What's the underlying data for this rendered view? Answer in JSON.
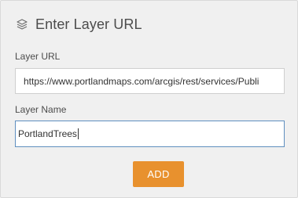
{
  "header": {
    "title": "Enter Layer URL",
    "icon": "layers-icon"
  },
  "form": {
    "url_label": "Layer URL",
    "url_value": "https://www.portlandmaps.com/arcgis/rest/services/Publi",
    "name_label": "Layer Name",
    "name_value": "PortlandTrees"
  },
  "actions": {
    "add_label": "ADD"
  },
  "colors": {
    "accent": "#e8912e",
    "focus_border": "#5f8fbf",
    "panel_bg": "#f0f0f0"
  }
}
